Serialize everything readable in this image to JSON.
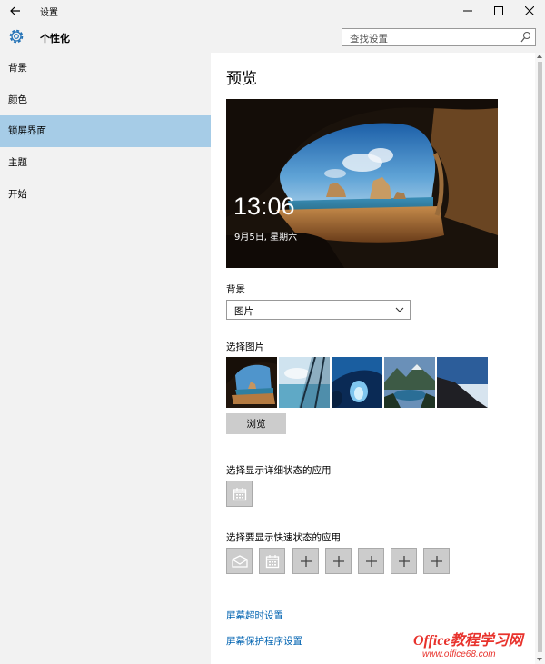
{
  "window": {
    "title": "设置",
    "controls": {
      "minimize": "—",
      "maximize": "☐",
      "close": "✕"
    }
  },
  "header": {
    "app_title": "个性化",
    "search_placeholder": "查找设置"
  },
  "sidebar": {
    "items": [
      {
        "label": "背景",
        "active": false
      },
      {
        "label": "颜色",
        "active": false
      },
      {
        "label": "锁屏界面",
        "active": true
      },
      {
        "label": "主题",
        "active": false
      },
      {
        "label": "开始",
        "active": false
      }
    ]
  },
  "main": {
    "preview_heading": "预览",
    "preview": {
      "time": "13:06",
      "date": "9月5日, 星期六"
    },
    "background_label": "背景",
    "background_select_value": "图片",
    "choose_picture_label": "选择图片",
    "picture_thumbnails": [
      "cave-beach",
      "glass-sky",
      "ice-cave",
      "mountain-lake",
      "cliff-sea"
    ],
    "browse_button": "浏览",
    "detailed_status_label": "选择显示详细状态的应用",
    "detailed_status_apps": [
      "calendar-icon"
    ],
    "quick_status_label": "选择要显示快速状态的应用",
    "quick_status_apps": [
      "mail-icon",
      "calendar-icon",
      "plus-icon",
      "plus-icon",
      "plus-icon",
      "plus-icon",
      "plus-icon"
    ],
    "screen_timeout_link": "屏幕超时设置",
    "screensaver_link": "屏幕保护程序设置"
  },
  "watermark": {
    "line1": "Office教程学习网",
    "line2": "www.office68.com"
  },
  "colors": {
    "sidebar_bg": "#f2f2f2",
    "active_item_bg": "#a6cce7",
    "link": "#0063b1",
    "button_bg": "#cccccc",
    "watermark": "#e8322c"
  }
}
